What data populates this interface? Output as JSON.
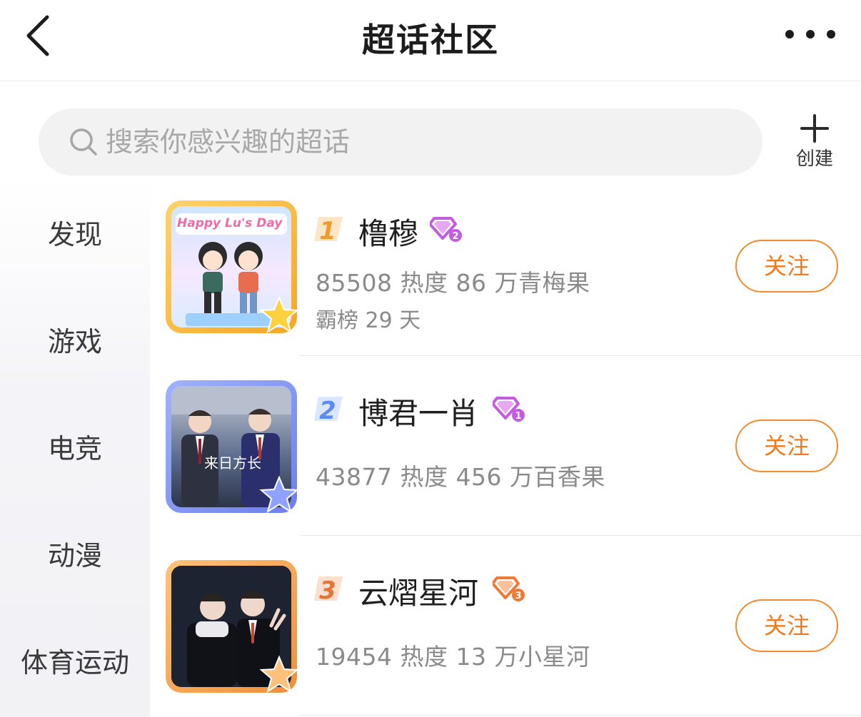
{
  "header": {
    "title": "超话社区"
  },
  "search": {
    "placeholder": "搜索你感兴趣的超话"
  },
  "create": {
    "label": "创建"
  },
  "sidebar": {
    "items": [
      {
        "label": "发现"
      },
      {
        "label": "游戏"
      },
      {
        "label": "电竞"
      },
      {
        "label": "动漫"
      },
      {
        "label": "体育运动"
      }
    ]
  },
  "topics": [
    {
      "rank": "1",
      "name": "橹穆",
      "badge_level": "2",
      "stats": "85508 热度  86 万青梅果",
      "extra": "霸榜 29 天",
      "follow_label": "关注",
      "avatar_text": "Happy Lu's Day",
      "frame_color": "#f7b53c"
    },
    {
      "rank": "2",
      "name": "博君一肖",
      "badge_level": "1",
      "stats": "43877 热度  456 万百香果",
      "extra": "",
      "follow_label": "关注",
      "avatar_text": "来日方长",
      "frame_color": "#7b8ff0"
    },
    {
      "rank": "3",
      "name": "云熠星河",
      "badge_level": "3",
      "stats": "19454 热度  13 万小星河",
      "extra": "",
      "follow_label": "关注",
      "avatar_text": "",
      "frame_color": "#f3a253"
    }
  ],
  "colors": {
    "accent": "#f07a1e",
    "rank1": "#f39a2c",
    "rank2": "#5b8def",
    "rank3": "#e2763a",
    "badge_purple": "#c35ce0",
    "badge_orange": "#ef7a35"
  }
}
